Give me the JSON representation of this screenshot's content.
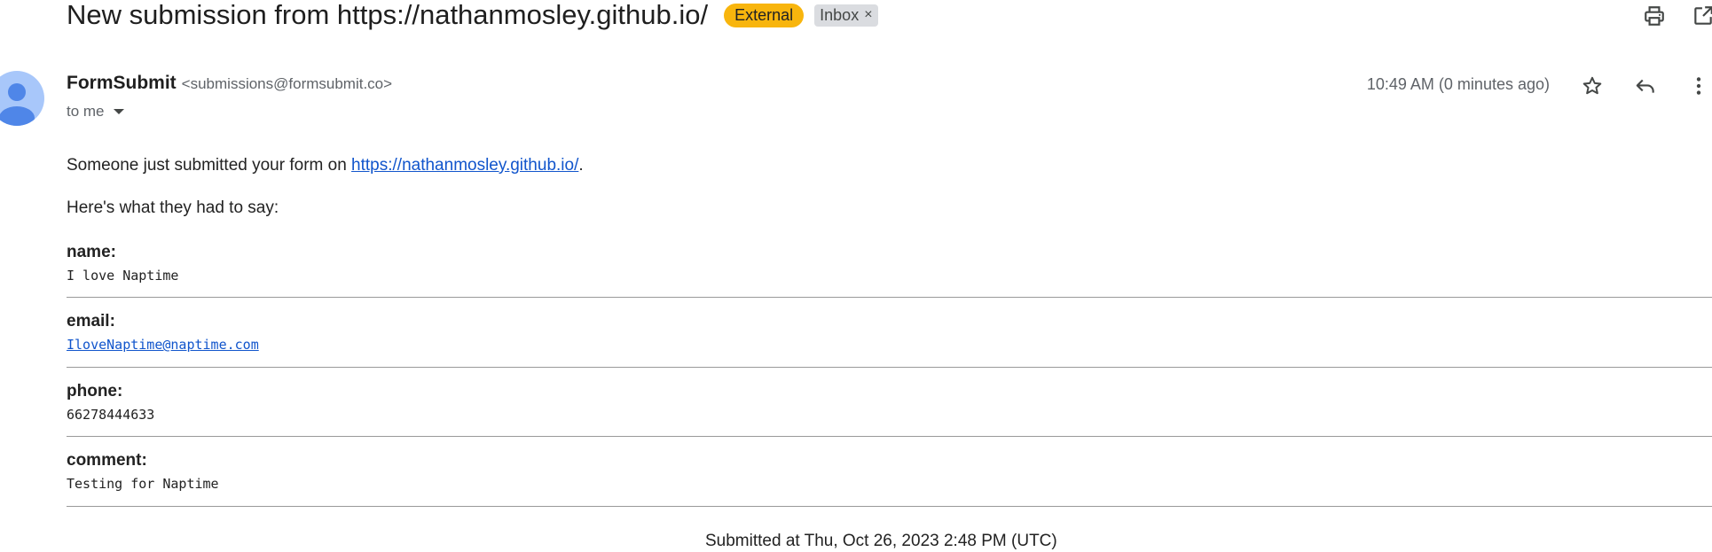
{
  "email": {
    "subject": "New submission from https://nathanmosley.github.io/",
    "labels": {
      "external": "External",
      "inbox": "Inbox",
      "inbox_remove": "×"
    },
    "sender": {
      "name": "FormSubmit",
      "email": "<submissions@formsubmit.co>"
    },
    "recipient": "to me",
    "timestamp": "10:49 AM (0 minutes ago)"
  },
  "content": {
    "intro_prefix": "Someone just submitted your form on ",
    "intro_link": "https://nathanmosley.github.io/",
    "intro_suffix": ".",
    "lead": "Here's what they had to say:",
    "fields": [
      {
        "label": "name:",
        "value": "I love Naptime"
      },
      {
        "label": "email:",
        "value": "IloveNaptime@naptime.com"
      },
      {
        "label": "phone:",
        "value": "66278444633"
      },
      {
        "label": "comment:",
        "value": "Testing for Naptime"
      }
    ],
    "footer": "Submitted at Thu, Oct 26, 2023 2:48 PM (UTC)"
  },
  "icons": {
    "print": "print-icon",
    "open_new_window": "open-in-new-window-icon",
    "star": "star-icon",
    "reply": "reply-icon",
    "more": "more-vert-icon",
    "avatar": "person-avatar-icon"
  },
  "colors": {
    "external_badge": "#f8b50d",
    "inbox_badge": "#dadce0",
    "avatar_bg": "#a8c7fa",
    "avatar_fg": "#4f86e8",
    "link": "#1155cc"
  }
}
